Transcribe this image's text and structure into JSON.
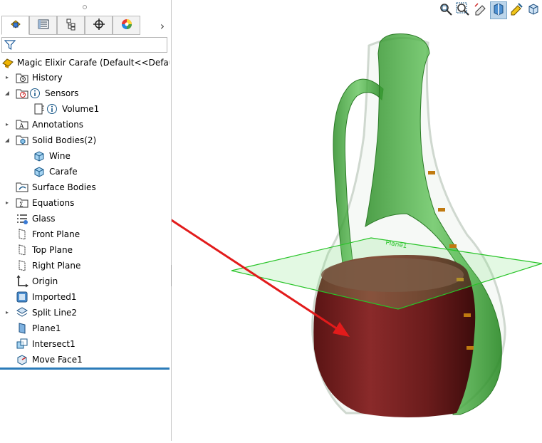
{
  "feature_tree": {
    "tabs": [
      {
        "icon": "feature-manager-icon",
        "active": true
      },
      {
        "icon": "property-manager-icon",
        "active": false
      },
      {
        "icon": "configuration-manager-icon",
        "active": false
      },
      {
        "icon": "dimxpert-manager-icon",
        "active": false
      },
      {
        "icon": "display-manager-icon",
        "active": false
      }
    ],
    "root_label": "Magic Elixir Carafe  (Default<<Default>_",
    "items": [
      {
        "label": "History",
        "icon": "history-folder-icon",
        "expander": true
      },
      {
        "label": "Sensors",
        "icon": "sensors-folder-icon",
        "expander": true
      },
      {
        "label": "Volume1",
        "icon": "volume-sensor-icon"
      },
      {
        "label": "Annotations",
        "icon": "annotations-icon",
        "expander": true
      },
      {
        "label": "Solid Bodies(2)",
        "icon": "solid-bodies-folder-icon",
        "expander": true
      },
      {
        "label": "Wine",
        "icon": "solid-body-icon"
      },
      {
        "label": "Carafe",
        "icon": "solid-body-icon"
      },
      {
        "label": "Surface Bodies",
        "icon": "surface-bodies-icon"
      },
      {
        "label": "Equations",
        "icon": "equations-icon",
        "expander": true
      },
      {
        "label": "Glass",
        "icon": "material-icon"
      },
      {
        "label": "Front Plane",
        "icon": "plane-icon"
      },
      {
        "label": "Top Plane",
        "icon": "plane-icon"
      },
      {
        "label": "Right Plane",
        "icon": "plane-icon"
      },
      {
        "label": "Origin",
        "icon": "origin-icon"
      },
      {
        "label": "Imported1",
        "icon": "imported-body-icon"
      },
      {
        "label": "Split Line2",
        "icon": "split-line-icon",
        "expander": true
      },
      {
        "label": "Plane1",
        "icon": "plane-feature-icon"
      },
      {
        "label": "Intersect1",
        "icon": "intersect-icon"
      },
      {
        "label": "Move Face1",
        "icon": "move-face-icon"
      }
    ]
  },
  "view_toolbar": [
    {
      "icon": "zoom-to-fit-icon"
    },
    {
      "icon": "zoom-to-area-icon"
    },
    {
      "icon": "previous-view-icon"
    },
    {
      "icon": "section-view-icon",
      "pressed": true
    },
    {
      "icon": "dynamic-annotation-icon"
    },
    {
      "icon": "view-orientation-icon"
    }
  ],
  "viewport": {
    "plane_label": "Plane1",
    "colors": {
      "glass": "#3fae3a",
      "wine": "#6e1c1c",
      "plane": "#2ecc2e",
      "arrow": "#e21b1b",
      "marks": "#c07a10"
    }
  }
}
